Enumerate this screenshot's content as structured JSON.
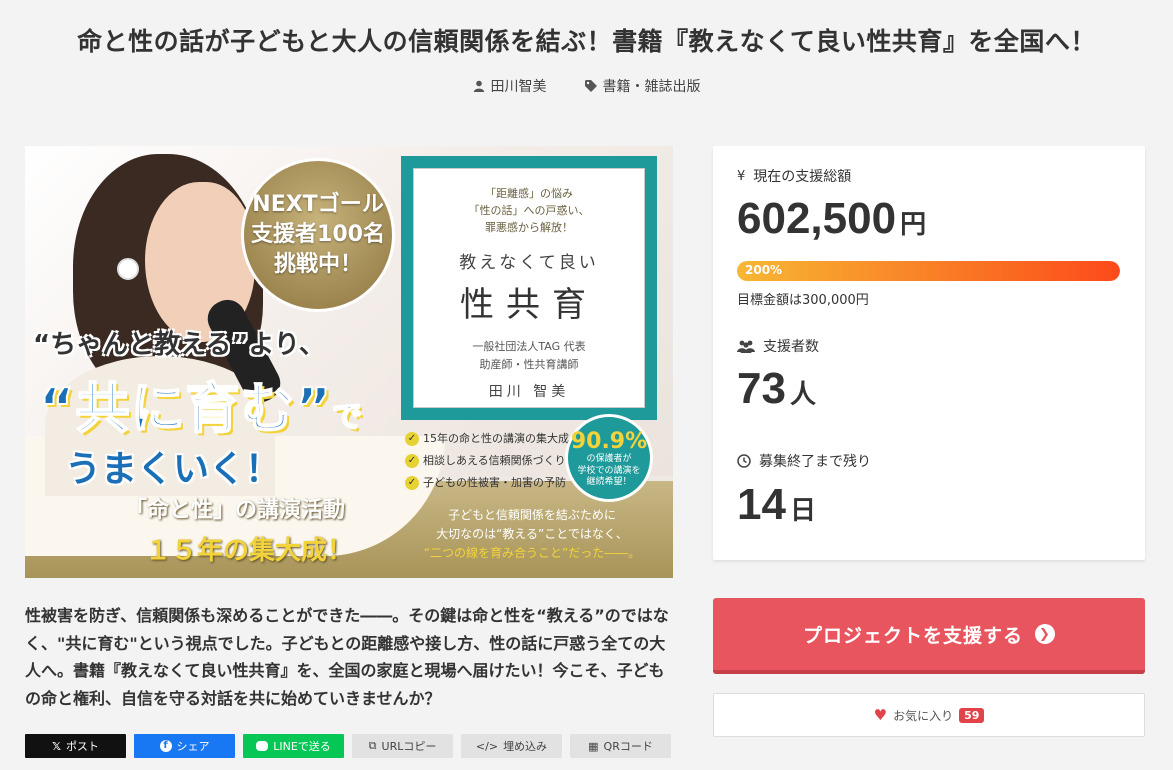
{
  "page": {
    "title": "命と性の話が子どもと大人の信頼関係を結ぶ！書籍『教えなくて良い性共育』を全国へ！",
    "author": "田川智美",
    "category": "書籍・雑誌出版"
  },
  "hero": {
    "badge_line1": "NEXTゴール",
    "badge_line2": "支援者100名",
    "badge_line3": "挑戦中！",
    "line1": "“ちゃんと教える”より、",
    "line2": "“共に育む”",
    "line2_suffix": "で",
    "line3": "うまくいく！",
    "line4": "「命と性」の講演活動",
    "line5": "１５年の集大成！",
    "book": {
      "sub1": "「距離感」の悩み",
      "sub2": "「性の話」への戸惑い、",
      "sub3": "罪悪感から解放！",
      "title1": "教えなくて良い",
      "title2": "性共育",
      "org1": "一般社団法人TAG 代表",
      "org2": "助産師・性共育講師",
      "author": "田川 智美"
    },
    "checks": [
      "15年の命と性の講演の集大成",
      "相談しあえる信頼関係づくり",
      "子どもの性被害・加害の予防"
    ],
    "stat_value": "90.9%",
    "stat_text1": "の保護者が",
    "stat_text2": "学校での講演を",
    "stat_text3": "継続希望！",
    "caption1": "子どもと信頼関係を結ぶために",
    "caption2": "大切なのは“教える”ことではなく、",
    "caption3": "“二つの線を育み合うこと”だった――。"
  },
  "panel": {
    "total_label": "現在の支援総額",
    "total_value": "602,500",
    "total_unit": "円",
    "progress_text": "200%",
    "progress_fraction": 1.0,
    "goal_text": "目標金額は300,000円",
    "supporters_label": "支援者数",
    "supporters_value": "73",
    "supporters_unit": "人",
    "remaining_label": "募集終了まで残り",
    "remaining_value": "14",
    "remaining_unit": "日"
  },
  "actions": {
    "support_label": "プロジェクトを支援する",
    "favorite_label": "お気に入り",
    "favorite_count": "59"
  },
  "description": "性被害を防ぎ、信頼関係も深めることができた――。その鍵は命と性を“教える”のではなく、\"共に育む\"という視点でした。子どもとの距離感や接し方、性の話に戸惑う全ての大人へ。書籍『教えなくて良い性共育』を、全国の家庭と現場へ届けたい！今こそ、子どもの命と権利、自信を守る対話を共に始めていきませんか？",
  "share": {
    "x": "ポスト",
    "facebook": "シェア",
    "line": "LINEで送る",
    "url": "URLコピー",
    "embed": "埋め込み",
    "qr": "QRコード"
  },
  "colors": {
    "support_button": "#e8555f",
    "progress_start": "#f7b733",
    "progress_end": "#fc4a1a",
    "book_teal": "#1e9a9a"
  }
}
